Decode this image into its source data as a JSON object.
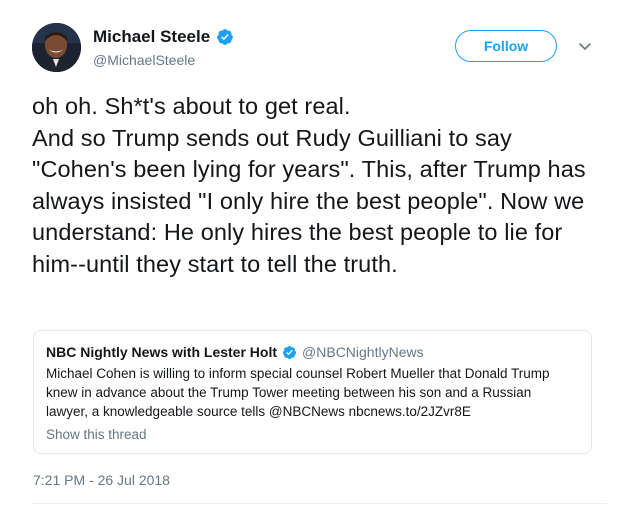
{
  "author": {
    "display_name": "Michael Steele",
    "handle": "@MichaelSteele",
    "verified_icon": "verified-badge-icon",
    "follow_label": "Follow"
  },
  "tweet": {
    "text": "oh oh. Sh*t's about to get real.\nAnd so Trump sends out Rudy Guilliani to say \"Cohen's been lying for years\". This, after Trump has always insisted \"I only hire the best people\". Now we understand: He only hires the best people to lie for him--until they start to tell the truth.",
    "timestamp": "7:21 PM - 26 Jul 2018"
  },
  "quoted_tweet": {
    "display_name": "NBC Nightly News with Lester Holt",
    "handle": "@NBCNightlyNews",
    "text": "Michael Cohen is willing to inform special counsel Robert Mueller that Donald Trump knew in advance about the Trump Tower meeting between his son and a Russian lawyer, a knowledgeable source tells @NBCNews nbcnews.to/2JZvr8E",
    "show_thread_label": "Show this thread"
  },
  "colors": {
    "accent": "#1da1f2",
    "secondary_text": "#657786",
    "border": "#e1e8ed"
  }
}
